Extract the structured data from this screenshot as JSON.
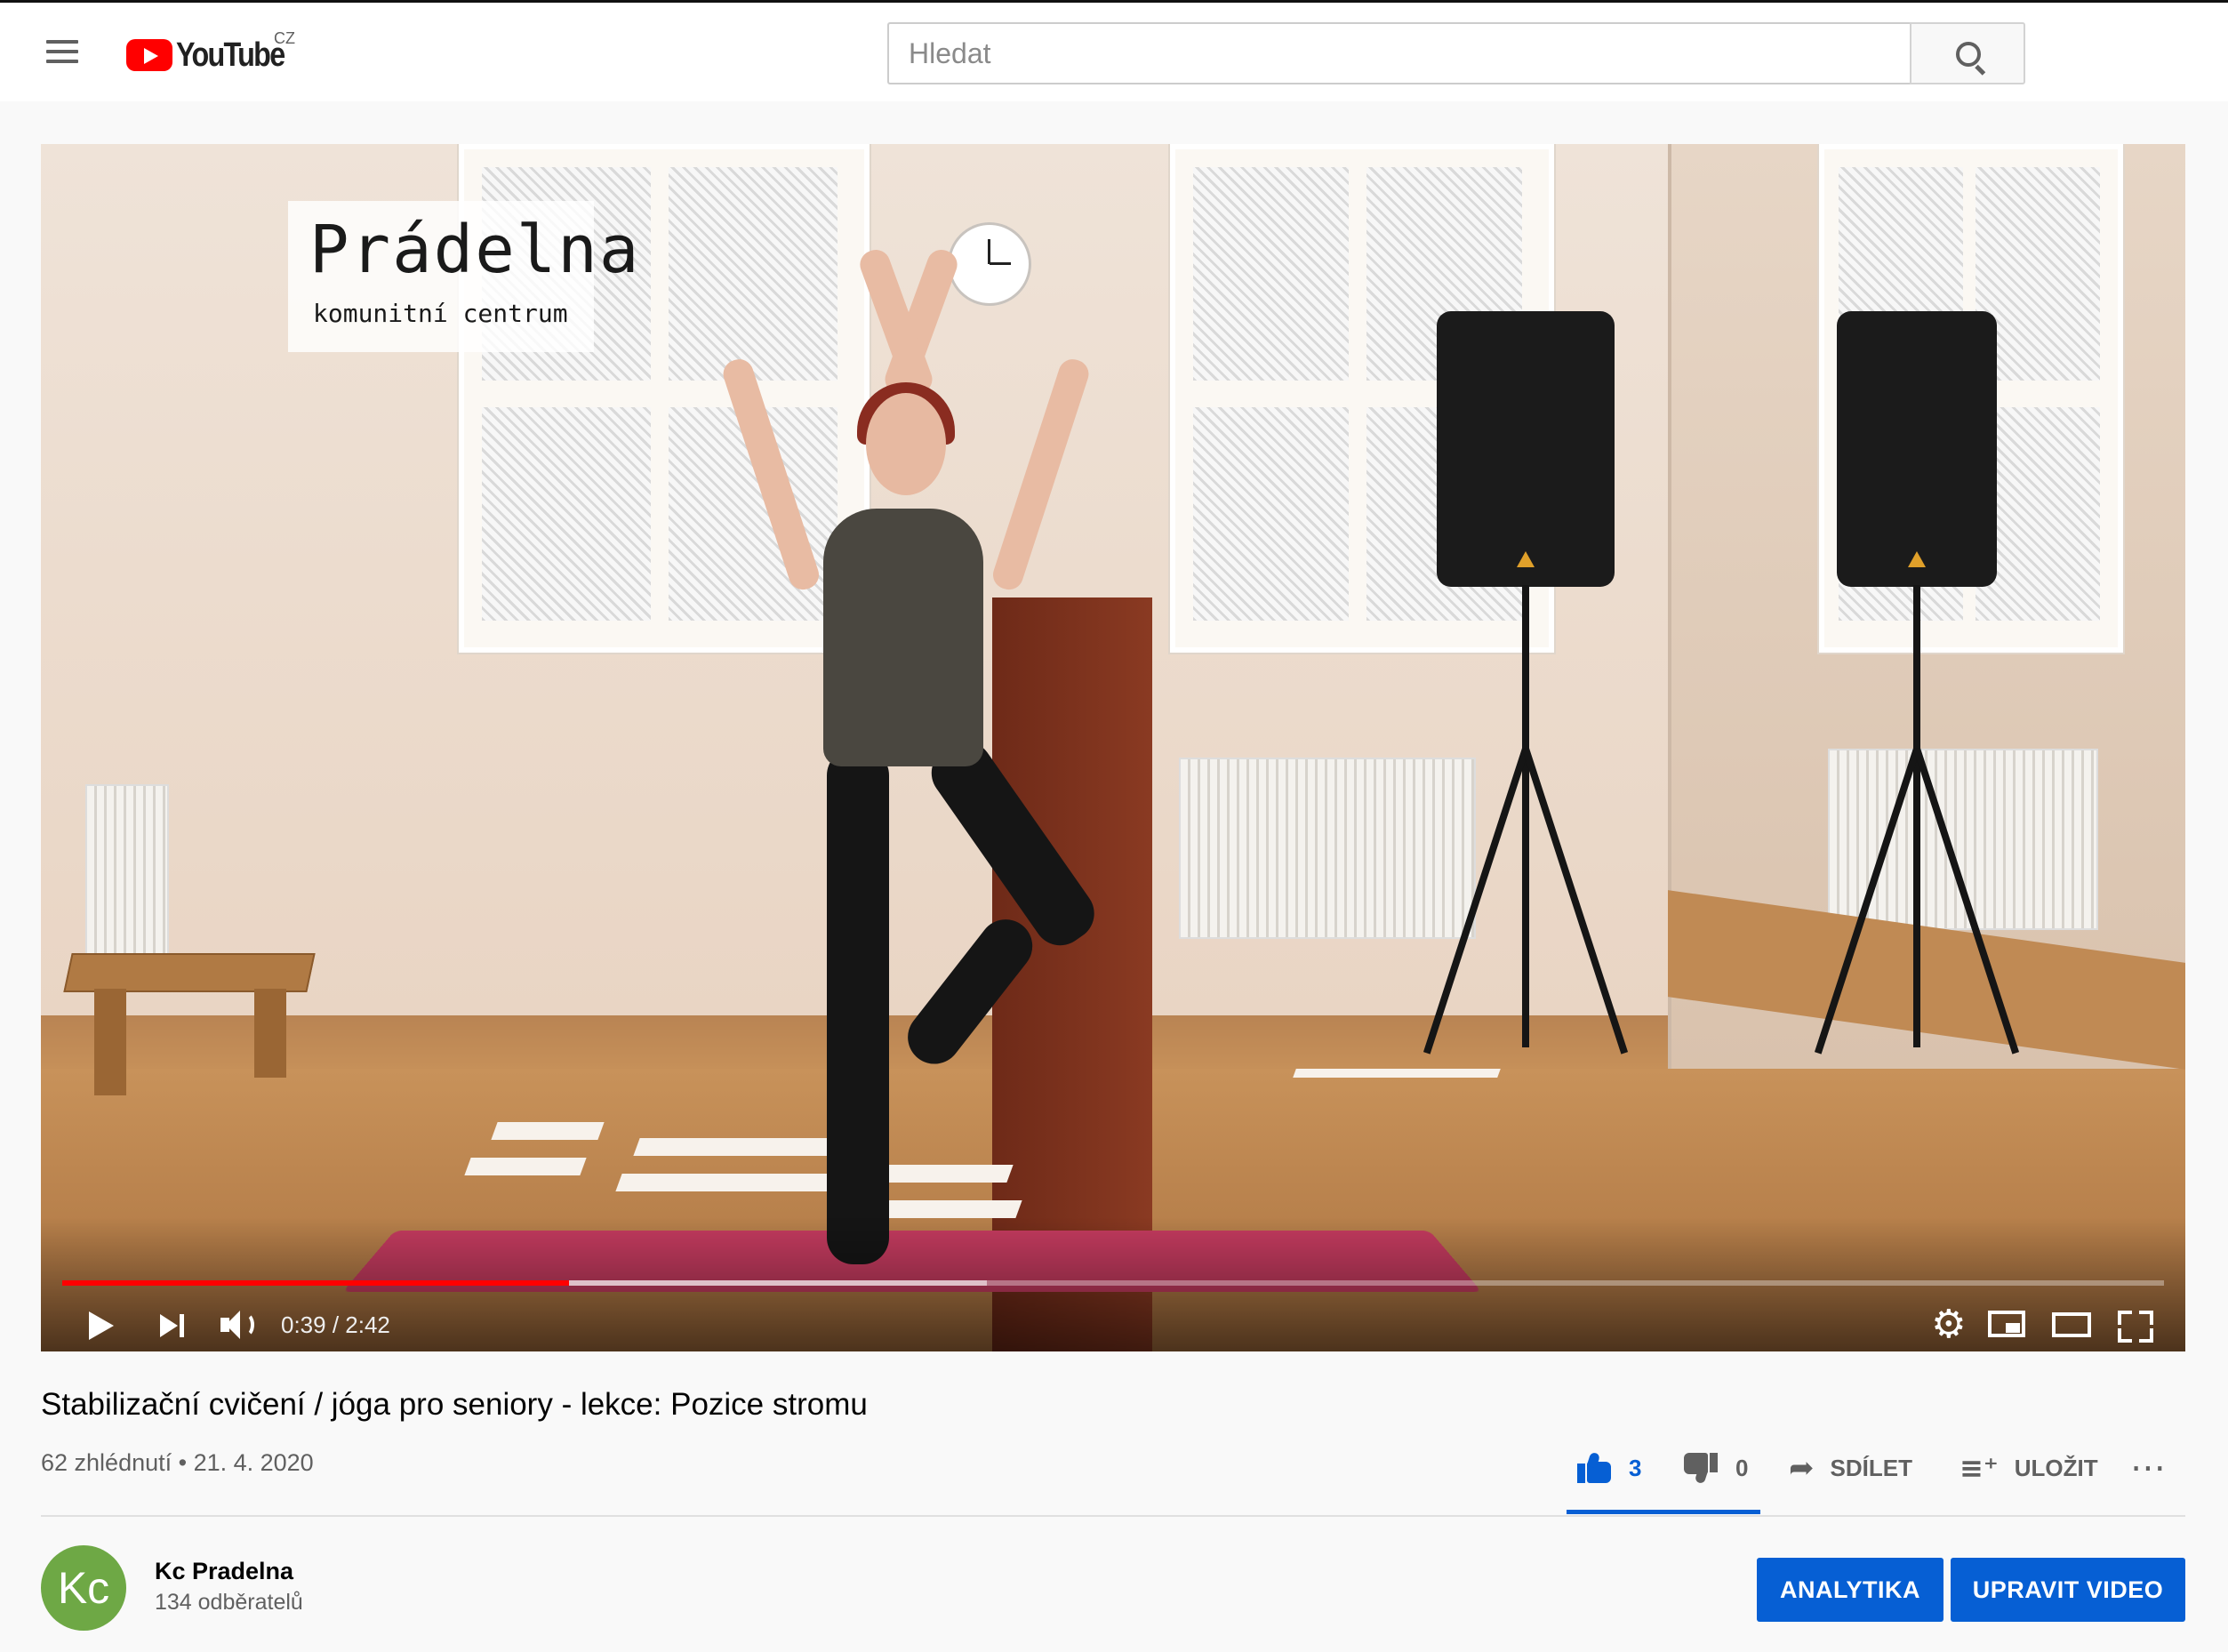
{
  "header": {
    "logo_text": "YouTube",
    "country_code": "CZ",
    "search_placeholder": "Hledat"
  },
  "player": {
    "watermark_title": "Prádelna",
    "watermark_subtitle": "komunitní centrum",
    "current_time": "0:39",
    "duration": "2:42",
    "time_display": "0:39 / 2:42",
    "played_fraction": 0.241,
    "buffered_fraction": 0.44
  },
  "video": {
    "title": "Stabilizační cvičení / jóga pro seniory - lekce: Pozice stromu",
    "views": "62 zhlédnutí",
    "date": "21. 4. 2020",
    "meta_text": "62 zhlédnutí • 21. 4. 2020"
  },
  "actions": {
    "likes": "3",
    "dislikes": "0",
    "share_label": "SDÍLET",
    "save_label": "ULOŽIT",
    "like_ratio": 1.0
  },
  "channel": {
    "avatar_text": "Kc",
    "name": "Kc Pradelna",
    "subscribers": "134 odběratelů",
    "analytics_label": "ANALYTIKA",
    "edit_label": "UPRAVIT VIDEO"
  },
  "colors": {
    "brand_red": "#ff0000",
    "accent_blue": "#065fd4",
    "avatar_green": "#6ea845"
  }
}
